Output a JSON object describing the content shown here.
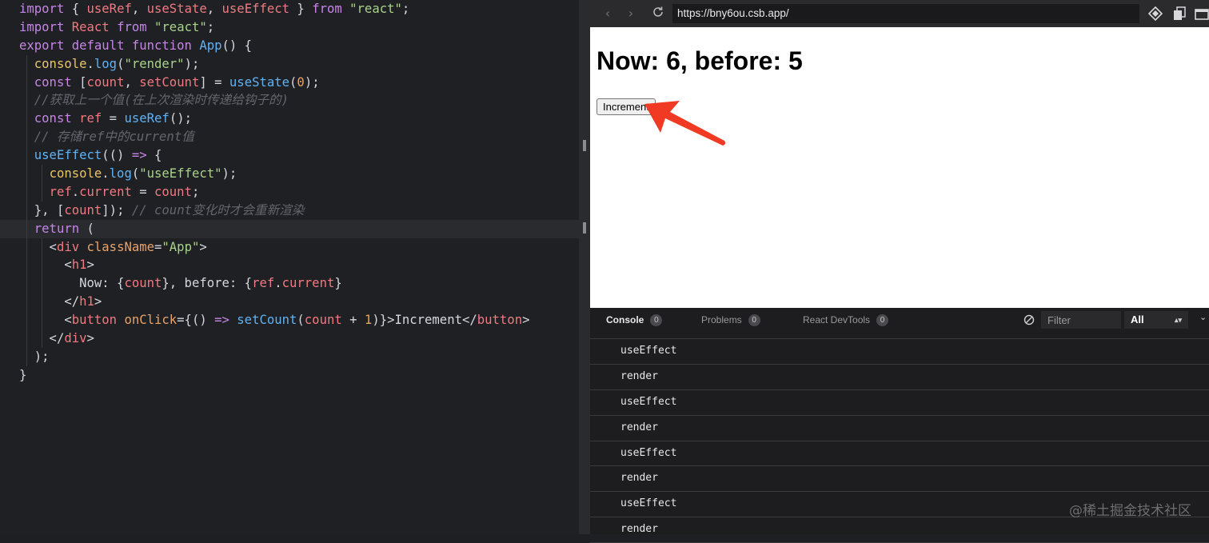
{
  "editor": {
    "lines": [
      [
        [
          "kw",
          "import"
        ],
        [
          "op",
          " { "
        ],
        [
          "var",
          "useRef"
        ],
        [
          "op",
          ", "
        ],
        [
          "var",
          "useState"
        ],
        [
          "op",
          ", "
        ],
        [
          "var",
          "useEffect"
        ],
        [
          "op",
          " } "
        ],
        [
          "kw",
          "from"
        ],
        [
          "op",
          " "
        ],
        [
          "str",
          "\"react\""
        ],
        [
          "op",
          ";"
        ]
      ],
      [
        [
          "kw",
          "import"
        ],
        [
          "op",
          " "
        ],
        [
          "var",
          "React"
        ],
        [
          "op",
          " "
        ],
        [
          "kw",
          "from"
        ],
        [
          "op",
          " "
        ],
        [
          "str",
          "\"react\""
        ],
        [
          "op",
          ";"
        ]
      ],
      [
        [
          "kw",
          "export"
        ],
        [
          "op",
          " "
        ],
        [
          "kw",
          "default"
        ],
        [
          "op",
          " "
        ],
        [
          "kw",
          "function"
        ],
        [
          "op",
          " "
        ],
        [
          "fn",
          "App"
        ],
        [
          "op",
          "() {"
        ]
      ],
      [
        [
          "op",
          "  "
        ],
        [
          "prop",
          "console"
        ],
        [
          "op",
          "."
        ],
        [
          "fn",
          "log"
        ],
        [
          "op",
          "("
        ],
        [
          "str",
          "\"render\""
        ],
        [
          "op",
          ");"
        ]
      ],
      [
        [
          "op",
          "  "
        ],
        [
          "kw",
          "const"
        ],
        [
          "op",
          " ["
        ],
        [
          "var",
          "count"
        ],
        [
          "op",
          ", "
        ],
        [
          "var",
          "setCount"
        ],
        [
          "op",
          "] = "
        ],
        [
          "fn",
          "useState"
        ],
        [
          "op",
          "("
        ],
        [
          "num",
          "0"
        ],
        [
          "op",
          ");"
        ]
      ],
      [
        [
          "op",
          "  "
        ],
        [
          "cm",
          "//获取上一个值(在上次渲染时传递给钩子的)"
        ]
      ],
      [
        [
          "op",
          "  "
        ],
        [
          "kw",
          "const"
        ],
        [
          "op",
          " "
        ],
        [
          "var",
          "ref"
        ],
        [
          "op",
          " = "
        ],
        [
          "fn",
          "useRef"
        ],
        [
          "op",
          "();"
        ]
      ],
      [
        [
          "op",
          "  "
        ],
        [
          "cm",
          "// 存储ref中的current值"
        ]
      ],
      [
        [
          "op",
          "  "
        ],
        [
          "fn",
          "useEffect"
        ],
        [
          "op",
          "(() "
        ],
        [
          "kw",
          "=>"
        ],
        [
          "op",
          " {"
        ]
      ],
      [
        [
          "op",
          "    "
        ],
        [
          "prop",
          "console"
        ],
        [
          "op",
          "."
        ],
        [
          "fn",
          "log"
        ],
        [
          "op",
          "("
        ],
        [
          "str",
          "\"useEffect\""
        ],
        [
          "op",
          ");"
        ]
      ],
      [
        [
          "op",
          "    "
        ],
        [
          "var",
          "ref"
        ],
        [
          "op",
          "."
        ],
        [
          "var",
          "current"
        ],
        [
          "op",
          " = "
        ],
        [
          "var",
          "count"
        ],
        [
          "op",
          ";"
        ]
      ],
      [
        [
          "op",
          "  }, ["
        ],
        [
          "var",
          "count"
        ],
        [
          "op",
          "]); "
        ],
        [
          "cm",
          "// count变化时才会重新渲染"
        ]
      ],
      [
        [
          "op",
          "  "
        ],
        [
          "kw",
          "return"
        ],
        [
          "op",
          " ("
        ]
      ],
      [
        [
          "op",
          "    <"
        ],
        [
          "tag",
          "div"
        ],
        [
          "op",
          " "
        ],
        [
          "attr",
          "className"
        ],
        [
          "op",
          "="
        ],
        [
          "str",
          "\"App\""
        ],
        [
          "op",
          ">"
        ]
      ],
      [
        [
          "op",
          "      <"
        ],
        [
          "tag",
          "h1"
        ],
        [
          "op",
          ">"
        ]
      ],
      [
        [
          "op",
          "        Now: {"
        ],
        [
          "var",
          "count"
        ],
        [
          "op",
          "}, before: {"
        ],
        [
          "var",
          "ref"
        ],
        [
          "op",
          "."
        ],
        [
          "var",
          "current"
        ],
        [
          "op",
          "}"
        ]
      ],
      [
        [
          "op",
          "      </"
        ],
        [
          "tag",
          "h1"
        ],
        [
          "op",
          ">"
        ]
      ],
      [
        [
          "op",
          "      <"
        ],
        [
          "tag",
          "button"
        ],
        [
          "op",
          " "
        ],
        [
          "attr",
          "onClick"
        ],
        [
          "op",
          "={() "
        ],
        [
          "kw",
          "=>"
        ],
        [
          "op",
          " "
        ],
        [
          "fn",
          "setCount"
        ],
        [
          "op",
          "("
        ],
        [
          "var",
          "count"
        ],
        [
          "op",
          " + "
        ],
        [
          "num",
          "1"
        ],
        [
          "op",
          ")}>Increment</"
        ],
        [
          "tag",
          "button"
        ],
        [
          "op",
          ">"
        ]
      ],
      [
        [
          "op",
          "    </"
        ],
        [
          "tag",
          "div"
        ],
        [
          "op",
          ">"
        ]
      ],
      [
        [
          "op",
          "  );"
        ]
      ],
      [
        [
          "op",
          "}"
        ]
      ]
    ],
    "active_line": 12
  },
  "browser": {
    "url": "https://bny6ou.csb.app/",
    "preview": {
      "heading": "Now: 6, before: 5",
      "button_label": "Increment"
    }
  },
  "devtools": {
    "tabs": [
      {
        "label": "Console",
        "count": "0"
      },
      {
        "label": "Problems",
        "count": "0"
      },
      {
        "label": "React DevTools",
        "count": "0"
      }
    ],
    "filter_placeholder": "Filter",
    "level": "All",
    "logs": [
      "useEffect",
      "render",
      "useEffect",
      "render",
      "useEffect",
      "render",
      "useEffect",
      "render"
    ]
  },
  "watermark": "@稀土掘金技术社区",
  "colors": {
    "annotation_arrow": "#f03a24"
  }
}
